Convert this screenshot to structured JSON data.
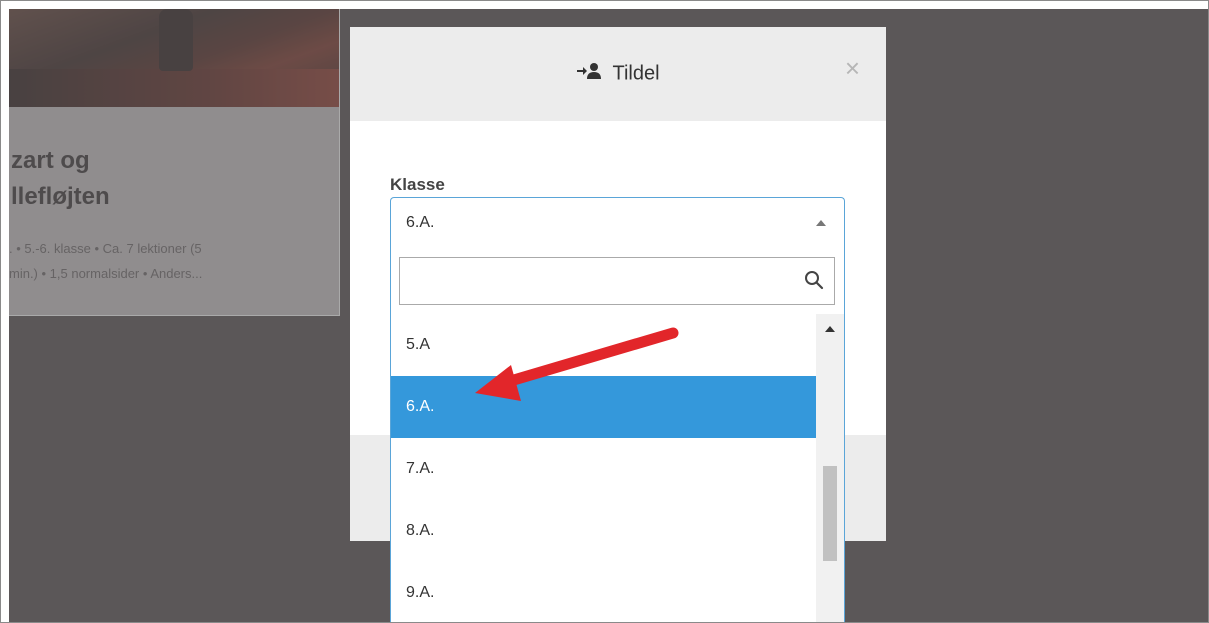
{
  "card": {
    "title": "zart og\nllefløjten",
    "meta": ". • 5.-6. klasse • Ca. 7 lektioner (5\nmin.) • 1,5 normalsider • Anders..."
  },
  "modal": {
    "title": "Tildel",
    "title_icon": "assign-user-icon",
    "close_label": "×",
    "field_label": "Klasse",
    "selected_value": "6.A."
  },
  "search": {
    "placeholder": "",
    "icon": "search-icon"
  },
  "options": [
    {
      "label": "5.A"
    },
    {
      "label": "6.A."
    },
    {
      "label": "7.A."
    },
    {
      "label": "8.A."
    },
    {
      "label": "9.A."
    }
  ],
  "colors": {
    "selected_bg": "#3498db",
    "annotation_arrow": "#e2262a",
    "overlay": "#5b5758"
  }
}
